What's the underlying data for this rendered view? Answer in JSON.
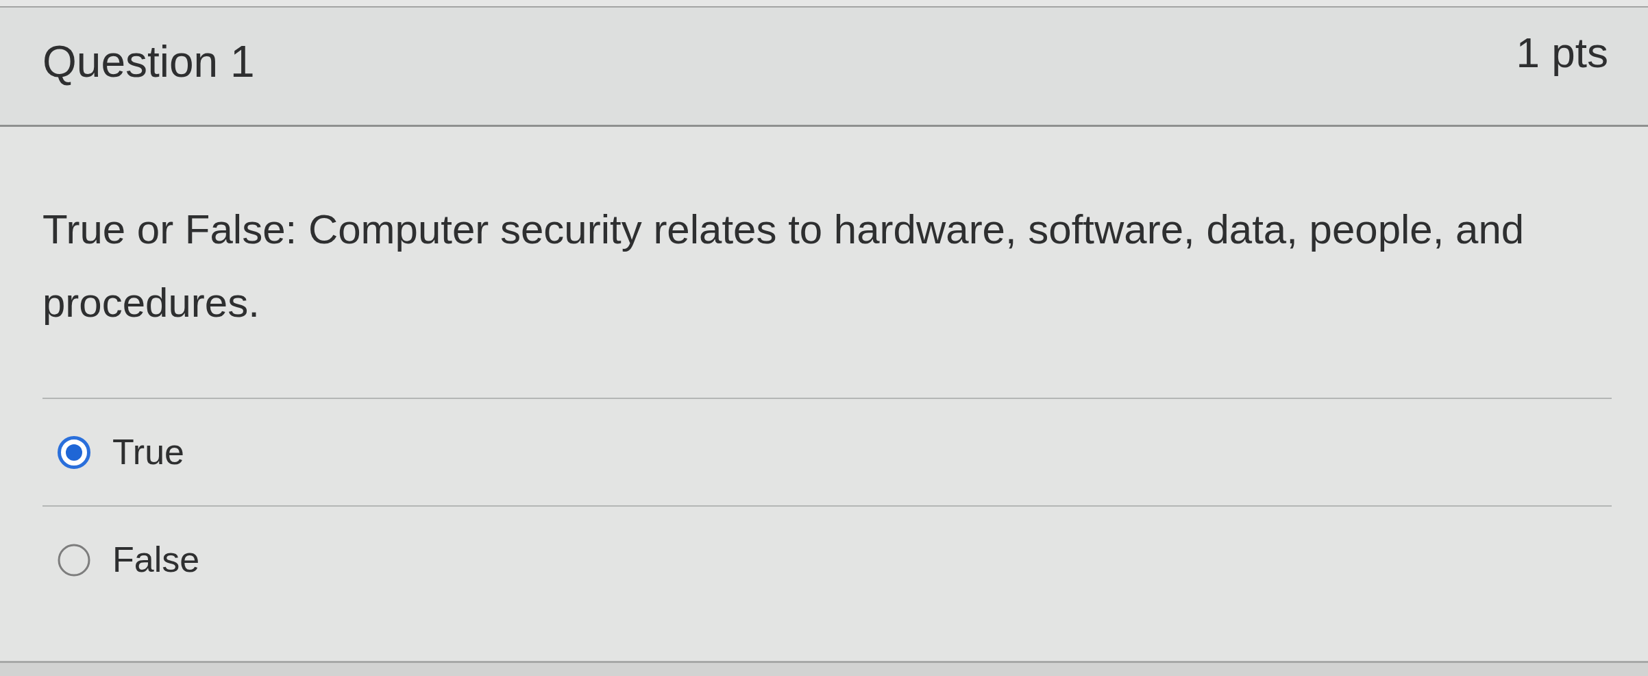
{
  "question": {
    "title": "Question 1",
    "points": "1 pts"
  },
  "prompt": "True or False: Computer security relates to hardware, software, data, people, and procedures.",
  "answers": [
    {
      "label": "True",
      "selected": true
    },
    {
      "label": "False",
      "selected": false
    }
  ]
}
